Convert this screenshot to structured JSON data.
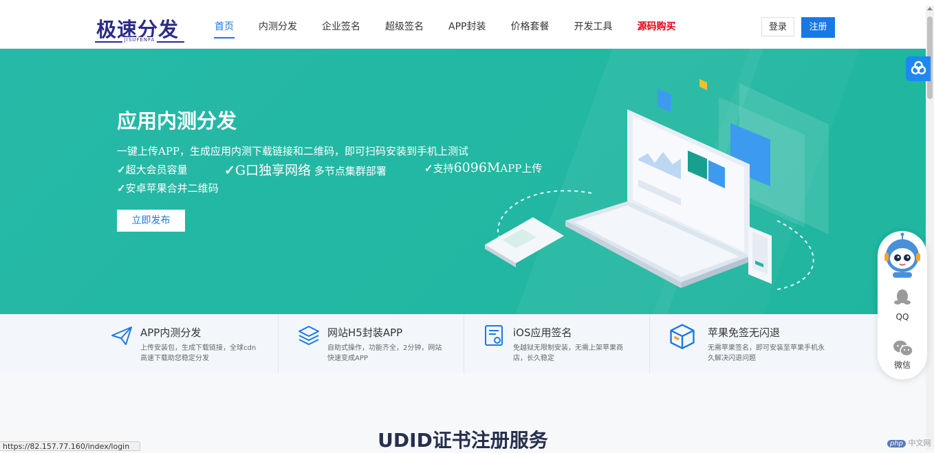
{
  "header": {
    "logo_main": "极速分发",
    "logo_sub": "JISUFENFA",
    "nav": [
      {
        "label": "首页",
        "active": true
      },
      {
        "label": "内测分发"
      },
      {
        "label": "企业签名"
      },
      {
        "label": "超级签名"
      },
      {
        "label": "APP封装"
      },
      {
        "label": "价格套餐"
      },
      {
        "label": "开发工具"
      },
      {
        "label": "源码购买",
        "highlight": true
      }
    ],
    "login": "登录",
    "register": "注册"
  },
  "hero": {
    "title": "应用内测分发",
    "desc": "一键上传APP，生成应用内测下载链接和二维码，即可扫码安装到手机上测试",
    "feat1": "超大会员容量",
    "feat2_big": "G口独享网络",
    "feat2_rest": " 多节点集群部署",
    "feat3_pre": "支持",
    "feat3_big": "6096M",
    "feat3_rest": "APP上传",
    "feat4": "安卓苹果合并二维码",
    "check": "✓",
    "cta": "立即发布"
  },
  "features": [
    {
      "title": "APP内测分发",
      "desc": "上传安装包，生成下载链接，全球cdn高速下载助您稳定分发"
    },
    {
      "title": "网站H5封装APP",
      "desc": "自助式操作，功能齐全，2分钟，网站快速变成APP"
    },
    {
      "title": "iOS应用签名",
      "desc": "免越狱无限制安装，无需上架苹果商店，长久稳定"
    },
    {
      "title": "苹果免签无闪退",
      "desc": "无需苹果签名，即可安装至苹果手机永久解决闪退问题"
    }
  ],
  "section_title": "UDID证书注册服务",
  "status_url": "https://82.157.77.160/index/login",
  "float": {
    "qq": "QQ",
    "wechat": "微信"
  },
  "php_badge": {
    "logo": "php",
    "text": "中文网"
  },
  "colors": {
    "primary": "#1a77e6",
    "hero": "#22b8a3",
    "logo": "#2b2c87",
    "highlight": "#e60012"
  }
}
